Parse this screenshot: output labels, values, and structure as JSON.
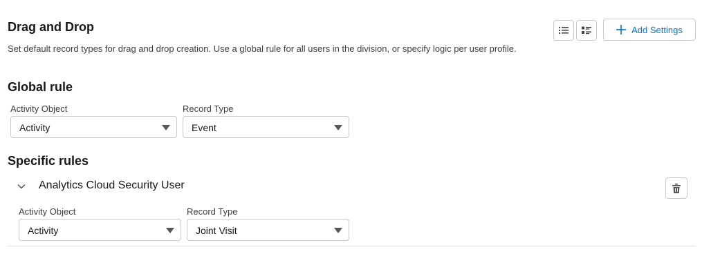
{
  "header": {
    "title": "Drag and Drop",
    "description": "Set default record types for drag and drop creation. Use a global rule for all users in the division, or specify logic per user profile.",
    "add_settings_label": "Add Settings"
  },
  "global_rule": {
    "heading": "Global rule",
    "activity_object_label": "Activity Object",
    "activity_object_value": "Activity",
    "record_type_label": "Record Type",
    "record_type_value": "Event"
  },
  "specific_rules": {
    "heading": "Specific rules",
    "rules": [
      {
        "name": "Analytics Cloud Security User",
        "activity_object_label": "Activity Object",
        "activity_object_value": "Activity",
        "record_type_label": "Record Type",
        "record_type_value": "Joint Visit"
      }
    ]
  },
  "icons": {
    "list_view": "list-view-icon",
    "tile_view": "tile-view-icon",
    "add": "plus-icon",
    "delete": "trash-icon",
    "expand": "chevron-down-icon",
    "dropdown": "caret-down-icon"
  },
  "colors": {
    "accent": "#0176d3",
    "border": "#c9c9c9",
    "text": "#181818",
    "muted_text": "#3e3e3c"
  }
}
